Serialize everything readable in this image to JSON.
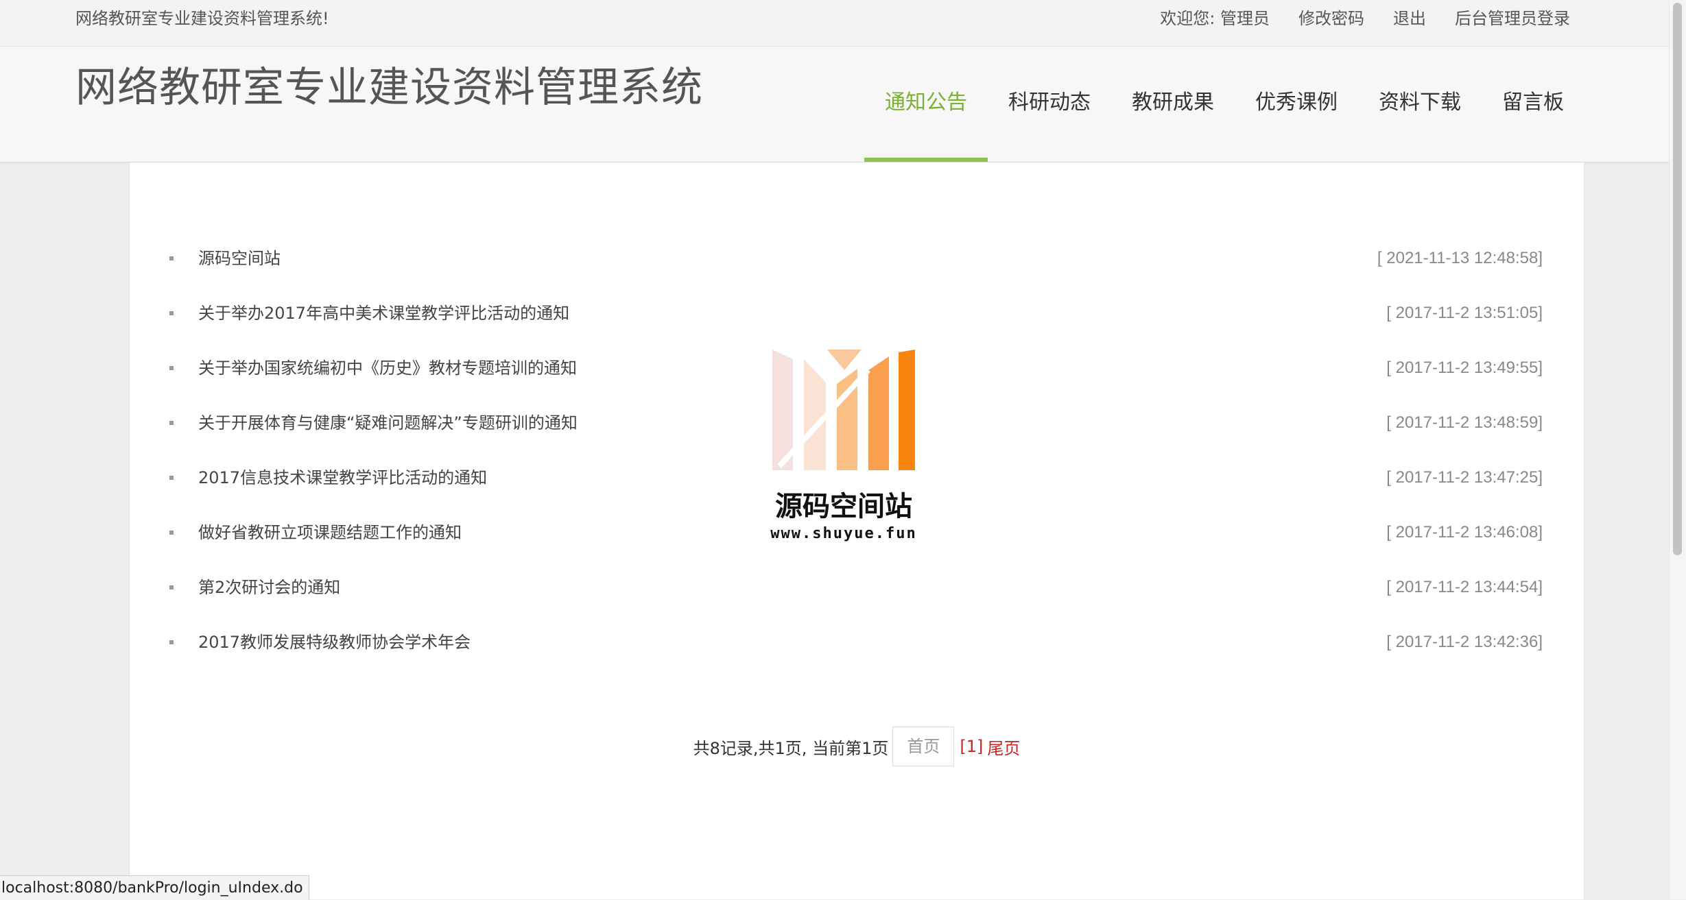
{
  "topbar": {
    "slogan": "网络教研室专业建设资料管理系统!",
    "welcome": "欢迎您: 管理员",
    "links": [
      "修改密码",
      "退出",
      "后台管理员登录"
    ]
  },
  "header": {
    "title": "网络教研室专业建设资料管理系统",
    "nav": [
      {
        "label": "通知公告",
        "active": true
      },
      {
        "label": "科研动态",
        "active": false
      },
      {
        "label": "教研成果",
        "active": false
      },
      {
        "label": "优秀课例",
        "active": false
      },
      {
        "label": "资料下载",
        "active": false
      },
      {
        "label": "留言板",
        "active": false
      }
    ]
  },
  "notices": [
    {
      "title": "源码空间站",
      "date": "[ 2021-11-13 12:48:58]"
    },
    {
      "title": "关于举办2017年高中美术课堂教学评比活动的通知",
      "date": "[ 2017-11-2 13:51:05]"
    },
    {
      "title": "关于举办国家统编初中《历史》教材专题培训的通知",
      "date": "[ 2017-11-2 13:49:55]"
    },
    {
      "title": "关于开展体育与健康“疑难问题解决”专题研训的通知",
      "date": "[ 2017-11-2 13:48:59]"
    },
    {
      "title": "2017信息技术课堂教学评比活动的通知",
      "date": "[ 2017-11-2 13:47:25]"
    },
    {
      "title": "做好省教研立项课题结题工作的通知",
      "date": "[ 2017-11-2 13:46:08]"
    },
    {
      "title": "第2次研讨会的通知",
      "date": "[ 2017-11-2 13:44:54]"
    },
    {
      "title": "2017教师发展特级教师协会学术年会",
      "date": "[ 2017-11-2 13:42:36]"
    }
  ],
  "pager": {
    "summary": "共8记录,共1页, 当前第1页",
    "first": "首页",
    "current": "[1]",
    "last": "尾页"
  },
  "watermark": {
    "title": "源码空间站",
    "url": "www.shuyue.fun"
  },
  "status_url": "localhost:8080/bankPro/login_uIndex.do",
  "colors": {
    "nav_active": "#7ab035",
    "nav_underline": "#8cc152",
    "pager_link": "#cc2222"
  }
}
